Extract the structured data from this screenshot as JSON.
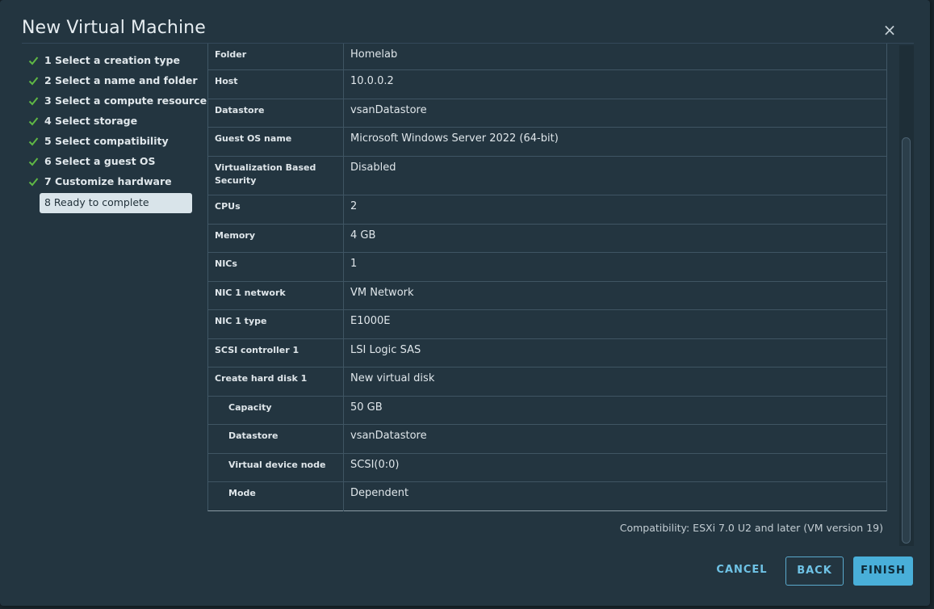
{
  "dialog": {
    "title": "New Virtual Machine",
    "close_label": "×"
  },
  "steps": [
    {
      "label": "1 Select a creation type",
      "done": true
    },
    {
      "label": "2 Select a name and folder",
      "done": true
    },
    {
      "label": "3 Select a compute resource",
      "done": true
    },
    {
      "label": "4 Select storage",
      "done": true
    },
    {
      "label": "5 Select compatibility",
      "done": true
    },
    {
      "label": "6 Select a guest OS",
      "done": true
    },
    {
      "label": "7 Customize hardware",
      "done": true
    },
    {
      "label": "8 Ready to complete",
      "done": false,
      "active": true
    }
  ],
  "summary": {
    "rows": [
      {
        "label": "Folder",
        "value": "Homelab"
      },
      {
        "label": "Host",
        "value": "10.0.0.2"
      },
      {
        "label": "Datastore",
        "value": "vsanDatastore"
      },
      {
        "label": "Guest OS name",
        "value": "Microsoft Windows Server 2022 (64-bit)"
      },
      {
        "label": "Virtualization Based Security",
        "value": "Disabled"
      },
      {
        "label": "CPUs",
        "value": "2"
      },
      {
        "label": "Memory",
        "value": "4 GB"
      },
      {
        "label": "NICs",
        "value": "1"
      },
      {
        "label": "NIC 1 network",
        "value": "VM Network"
      },
      {
        "label": "NIC 1 type",
        "value": "E1000E"
      },
      {
        "label": "SCSI controller 1",
        "value": "LSI Logic SAS"
      },
      {
        "label": "Create hard disk 1",
        "value": "New virtual disk"
      },
      {
        "label": "Capacity",
        "value": "50 GB",
        "indent": true
      },
      {
        "label": "Datastore",
        "value": "vsanDatastore",
        "indent": true
      },
      {
        "label": "Virtual device node",
        "value": "SCSI(0:0)",
        "indent": true
      },
      {
        "label": "Mode",
        "value": "Dependent",
        "indent": true
      }
    ]
  },
  "compatibility": "Compatibility: ESXi 7.0 U2 and later (VM version 19)",
  "buttons": {
    "cancel": "CANCEL",
    "back": "BACK",
    "finish": "FINISH"
  },
  "colors": {
    "dialog_bg": "#233540",
    "check_green": "#5fb845",
    "primary": "#49afd9",
    "link": "#6fc3e6"
  }
}
